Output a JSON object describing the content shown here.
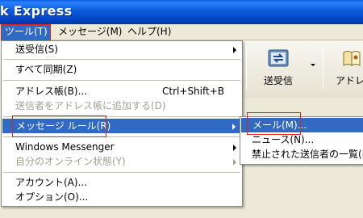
{
  "window": {
    "title": "k Express"
  },
  "menubar": {
    "items": [
      {
        "label": "ツール(T)"
      },
      {
        "label": "メッセージ(M)"
      },
      {
        "label": "ヘルプ(H)"
      }
    ]
  },
  "toolbar": {
    "send_receive_label": "送受信",
    "addresses_label": "アドレ"
  },
  "tools_menu": {
    "items": [
      {
        "label": "送受信(S)",
        "submenu": true,
        "enabled": true
      },
      {
        "label": "すべて同期(Z)",
        "enabled": true
      },
      {
        "label": "アドレス帳(B)...",
        "shortcut": "Ctrl+Shift+B",
        "enabled": true
      },
      {
        "label": "送信者をアドレス帳に追加する(D)",
        "enabled": false
      },
      {
        "label": "メッセージ ルール(R)",
        "submenu": true,
        "highlighted": true,
        "enabled": true
      },
      {
        "label": "Windows Messenger",
        "submenu": true,
        "enabled": true
      },
      {
        "label": "自分のオンライン状態(Y)",
        "submenu": true,
        "enabled": false
      },
      {
        "label": "アカウント(A)...",
        "enabled": true
      },
      {
        "label": "オプション(O)...",
        "enabled": true
      }
    ]
  },
  "rules_submenu": {
    "items": [
      {
        "label": "メール(M)...",
        "highlighted": true
      },
      {
        "label": "ニュース(N)..."
      },
      {
        "label": "禁止された送信者の一覧(B)"
      }
    ]
  },
  "colors": {
    "highlight": "#316ac5",
    "annotation": "#e2231a",
    "titlebar": "#0b5bd8"
  }
}
